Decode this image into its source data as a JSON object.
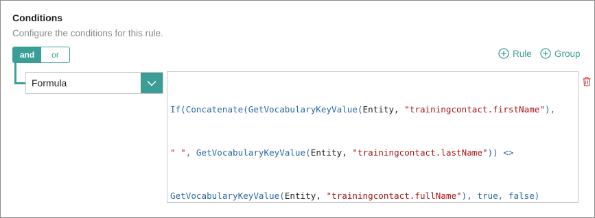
{
  "header": {
    "title": "Conditions",
    "subtitle": "Configure the conditions for this rule."
  },
  "operator_toggle": {
    "options": [
      "and",
      "or"
    ],
    "selected": "and"
  },
  "actions": {
    "rule_label": "Rule",
    "group_label": "Group"
  },
  "condition": {
    "type_select": {
      "value": "Formula"
    },
    "formula": {
      "line1": [
        {
          "t": "If(Concatenate(GetVocabularyKeyValue(",
          "c": "fn"
        },
        {
          "t": "Entity, ",
          "c": "pl"
        },
        {
          "t": "\"trainingcontact.firstName\"",
          "c": "str"
        },
        {
          "t": "),",
          "c": "fn"
        }
      ],
      "line2": [
        {
          "t": "\" \"",
          "c": "str"
        },
        {
          "t": ", GetVocabularyKeyValue(",
          "c": "fn"
        },
        {
          "t": "Entity, ",
          "c": "pl"
        },
        {
          "t": "\"trainingcontact.lastName\"",
          "c": "str"
        },
        {
          "t": ")) <>",
          "c": "fn"
        }
      ],
      "line3": [
        {
          "t": "GetVocabularyKeyValue(",
          "c": "fn"
        },
        {
          "t": "Entity, ",
          "c": "pl"
        },
        {
          "t": "\"trainingcontact.fullName\"",
          "c": "str"
        },
        {
          "t": "), true, false)",
          "c": "fn"
        }
      ]
    }
  },
  "icons": {
    "rule": "plus-circle-icon",
    "group": "plus-circle-icon",
    "chevron": "chevron-down-icon",
    "delete": "trash-icon"
  },
  "colors": {
    "accent": "#3a9e96",
    "function": "#2a67a7",
    "string": "#a31515",
    "delete": "#d13438"
  }
}
